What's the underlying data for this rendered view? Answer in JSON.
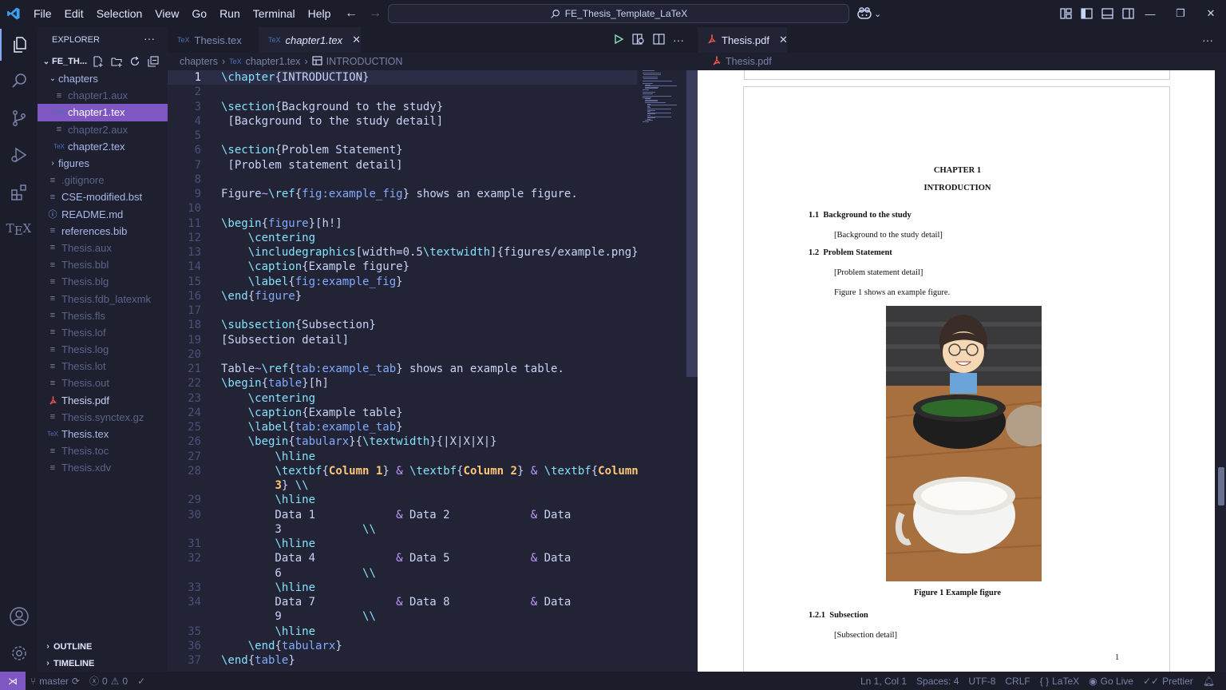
{
  "titlebar": {
    "menus": [
      "File",
      "Edit",
      "Selection",
      "View",
      "Go",
      "Run",
      "Terminal",
      "Help"
    ],
    "search_text": "FE_Thesis_Template_LaTeX",
    "window_controls": [
      "—",
      "❐",
      "✕"
    ]
  },
  "explorer": {
    "title": "EXPLORER",
    "root": "FE_TH...",
    "files": [
      {
        "name": "chapters",
        "kind": "folder-open",
        "depth": 1
      },
      {
        "name": "chapter1.aux",
        "kind": "dim",
        "depth": 2
      },
      {
        "name": "chapter1.tex",
        "kind": "tex",
        "depth": 2,
        "selected": true
      },
      {
        "name": "chapter2.aux",
        "kind": "dim",
        "depth": 2
      },
      {
        "name": "chapter2.tex",
        "kind": "tex",
        "depth": 2
      },
      {
        "name": "figures",
        "kind": "folder",
        "depth": 1
      },
      {
        "name": ".gitignore",
        "kind": "dim",
        "depth": 1
      },
      {
        "name": "CSE-modified.bst",
        "kind": "normal",
        "depth": 1
      },
      {
        "name": "README.md",
        "kind": "info",
        "depth": 1
      },
      {
        "name": "references.bib",
        "kind": "normal",
        "depth": 1
      },
      {
        "name": "Thesis.aux",
        "kind": "dim",
        "depth": 1
      },
      {
        "name": "Thesis.bbl",
        "kind": "dim",
        "depth": 1
      },
      {
        "name": "Thesis.blg",
        "kind": "dim",
        "depth": 1
      },
      {
        "name": "Thesis.fdb_latexmk",
        "kind": "dim",
        "depth": 1
      },
      {
        "name": "Thesis.fls",
        "kind": "dim",
        "depth": 1
      },
      {
        "name": "Thesis.lof",
        "kind": "dim",
        "depth": 1
      },
      {
        "name": "Thesis.log",
        "kind": "dim",
        "depth": 1
      },
      {
        "name": "Thesis.lot",
        "kind": "dim",
        "depth": 1
      },
      {
        "name": "Thesis.out",
        "kind": "dim",
        "depth": 1
      },
      {
        "name": "Thesis.pdf",
        "kind": "pdf",
        "depth": 1
      },
      {
        "name": "Thesis.synctex.gz",
        "kind": "dim",
        "depth": 1
      },
      {
        "name": "Thesis.tex",
        "kind": "tex",
        "depth": 1
      },
      {
        "name": "Thesis.toc",
        "kind": "dim",
        "depth": 1
      },
      {
        "name": "Thesis.xdv",
        "kind": "dim",
        "depth": 1
      }
    ],
    "outline": "OUTLINE",
    "timeline": "TIMELINE"
  },
  "editor1": {
    "tabs": [
      {
        "label": "Thesis.tex",
        "active": false
      },
      {
        "label": "chapter1.tex",
        "active": true
      }
    ],
    "breadcrumb": [
      "chapters",
      "chapter1.tex",
      "INTRODUCTION"
    ],
    "lines": [
      {
        "n": "1",
        "text": "\\chapter{INTRODUCTION}"
      },
      {
        "n": "2",
        "text": ""
      },
      {
        "n": "3",
        "text": "\\section{Background to the study}"
      },
      {
        "n": "4",
        "text": " [Background to the study detail]"
      },
      {
        "n": "5",
        "text": ""
      },
      {
        "n": "6",
        "text": "\\section{Problem Statement}"
      },
      {
        "n": "7",
        "text": " [Problem statement detail]"
      },
      {
        "n": "8",
        "text": ""
      },
      {
        "n": "9",
        "text": "Figure~\\ref{fig:example_fig} shows an example figure."
      },
      {
        "n": "10",
        "text": ""
      },
      {
        "n": "11",
        "text": "\\begin{figure}[h!]"
      },
      {
        "n": "12",
        "text": "    \\centering"
      },
      {
        "n": "13",
        "text": "    \\includegraphics[width=0.5\\textwidth]{figures/example.png}"
      },
      {
        "n": "14",
        "text": "    \\caption{Example figure}"
      },
      {
        "n": "15",
        "text": "    \\label{fig:example_fig}"
      },
      {
        "n": "16",
        "text": "\\end{figure}"
      },
      {
        "n": "17",
        "text": ""
      },
      {
        "n": "18",
        "text": "\\subsection{Subsection}"
      },
      {
        "n": "19",
        "text": "[Subsection detail]"
      },
      {
        "n": "20",
        "text": ""
      },
      {
        "n": "21",
        "text": "Table~\\ref{tab:example_tab} shows an example table."
      },
      {
        "n": "22",
        "text": "\\begin{table}[h]"
      },
      {
        "n": "23",
        "text": "    \\centering"
      },
      {
        "n": "24",
        "text": "    \\caption{Example table}"
      },
      {
        "n": "25",
        "text": "    \\label{tab:example_tab}"
      },
      {
        "n": "26",
        "text": "    \\begin{tabularx}{\\textwidth}{|X|X|X|}"
      },
      {
        "n": "27",
        "text": "        \\hline"
      },
      {
        "n": "28",
        "text": "        \\textbf{Column 1} & \\textbf{Column 2} & \\textbf{Column"
      },
      {
        "n": "",
        "text": "        3} \\\\"
      },
      {
        "n": "29",
        "text": "        \\hline"
      },
      {
        "n": "30",
        "text": "        Data 1            & Data 2            & Data"
      },
      {
        "n": "",
        "text": "        3            \\\\"
      },
      {
        "n": "31",
        "text": "        \\hline"
      },
      {
        "n": "32",
        "text": "        Data 4            & Data 5            & Data"
      },
      {
        "n": "",
        "text": "        6            \\\\"
      },
      {
        "n": "33",
        "text": "        \\hline"
      },
      {
        "n": "34",
        "text": "        Data 7            & Data 8            & Data"
      },
      {
        "n": "",
        "text": "        9            \\\\"
      },
      {
        "n": "35",
        "text": "        \\hline"
      },
      {
        "n": "36",
        "text": "    \\end{tabularx}"
      },
      {
        "n": "37",
        "text": "\\end{table}"
      }
    ]
  },
  "editor2": {
    "tab": "Thesis.pdf",
    "breadcrumb": "Thesis.pdf"
  },
  "pdf": {
    "chapter_label": "CHAPTER 1",
    "chapter_title": "INTRODUCTION",
    "s1_num": "1.1",
    "s1_title": "Background to the study",
    "s1_body": "[Background to the study detail]",
    "s2_num": "1.2",
    "s2_title": "Problem Statement",
    "s2_body": "[Problem statement detail]",
    "fig_ref_text": "Figure 1 shows an example figure.",
    "fig_caption": "Figure 1 Example figure",
    "ss_num": "1.2.1",
    "ss_title": "Subsection",
    "ss_body": "[Subsection detail]",
    "page_number": "1"
  },
  "status": {
    "branch": "master",
    "errors": "0",
    "warnings": "0",
    "cursor": "Ln 1, Col 1",
    "spaces": "Spaces: 4",
    "encoding": "UTF-8",
    "eol": "CRLF",
    "language": "LaTeX",
    "golive": "Go Live",
    "prettier": "Prettier"
  },
  "colors": {
    "accent": "#7e57c2",
    "keyword": "#86e1fc",
    "argument": "#82aaff",
    "operator": "#c099ff",
    "bold_arg": "#ffc777"
  }
}
